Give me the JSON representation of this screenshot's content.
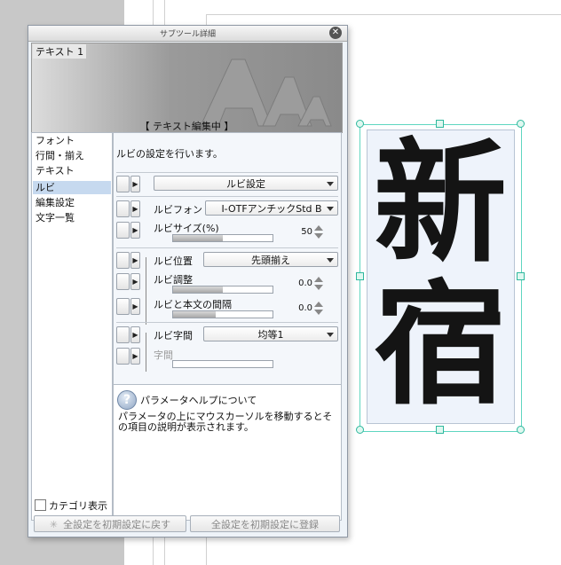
{
  "panel": {
    "title": "サブツール詳細",
    "preview": {
      "label": "テキスト 1",
      "status": "【 テキスト編集中 】"
    },
    "categories": [
      "フォント",
      "行間・揃え",
      "テキスト",
      "ルビ",
      "編集設定",
      "文字一覧"
    ],
    "selected_category": "ルビ",
    "category_display_label": "カテゴリ表示",
    "description": "ルビの設定を行います。",
    "settings": {
      "ruby_setting": "ルビ設定",
      "ruby_font_label": "ルビフォント",
      "ruby_font_value": "I-OTFアンチックStd B",
      "ruby_size_label": "ルビサイズ(%)",
      "ruby_size_value": "50",
      "ruby_size_fraction": 0.5,
      "ruby_position_label": "ルビ位置",
      "ruby_position_value": "先頭揃え",
      "ruby_adjust_label": "ルビ調整",
      "ruby_adjust_value": "0.0",
      "ruby_spacing_label": "ルビと本文の間隔",
      "ruby_spacing_value": "0.0",
      "ruby_kerning_label": "ルビ字間",
      "ruby_kerning_value": "均等1",
      "kerning_label": "字間"
    },
    "help": {
      "title": "パラメータヘルプについて",
      "body": "パラメータの上にマウスカーソルを移動するとその項目の説明が表示されます。"
    },
    "buttons": {
      "reset_all": "全設定を初期設定に戻す",
      "register_all": "全設定を初期設定に登録"
    }
  },
  "canvas": {
    "text_chars": [
      "新",
      "宿"
    ]
  },
  "colors": {
    "selection_frame": "#5fd6c0",
    "selected_category_bg": "#c6d9ef"
  },
  "icons": [
    "close-icon",
    "eye-icon",
    "expand-arrow-icon",
    "dropdown-icon",
    "spin-icon",
    "help-icon",
    "reset-icon"
  ]
}
